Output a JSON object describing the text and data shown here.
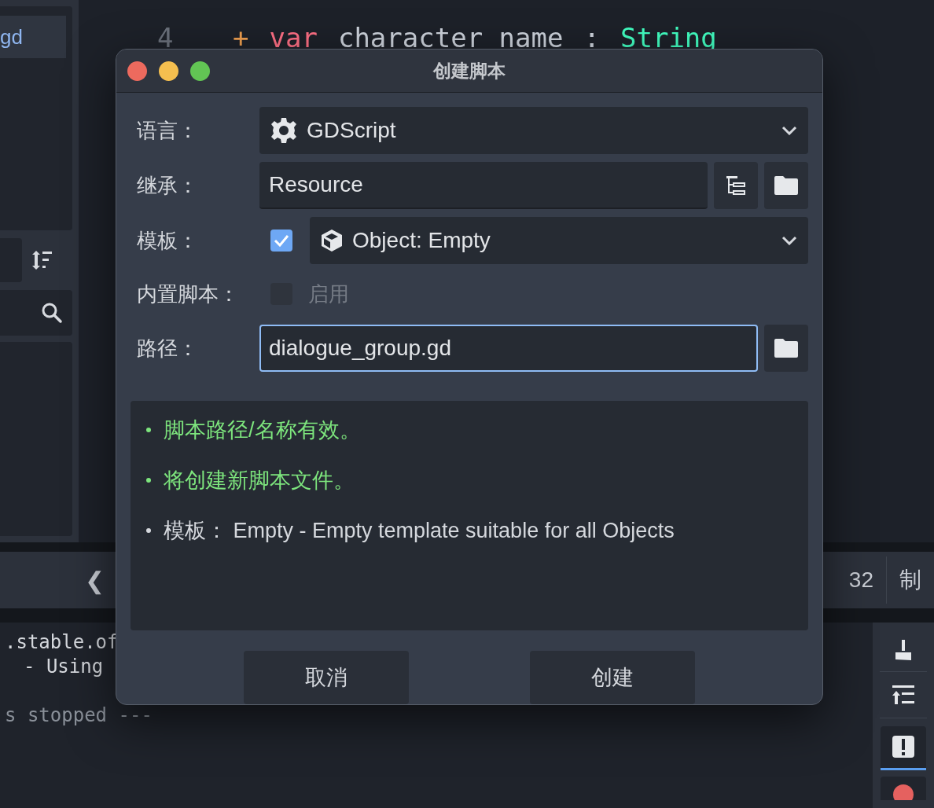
{
  "editor": {
    "file_item": {
      "label": "gd",
      "selected": true
    },
    "code_line": {
      "number": "4",
      "marker": "+",
      "keyword": "var",
      "name": "character name",
      "colon": ":",
      "type": "String"
    },
    "status_bar": {
      "back": "❮",
      "column": "32",
      "indent": "制"
    },
    "output_lines": [
      {
        "text": ".stable.of",
        "kind": "normal"
      },
      {
        "text": "- Using",
        "kind": "normal"
      },
      {
        "text": "s stopped ---",
        "kind": "muted"
      }
    ]
  },
  "dialog": {
    "title": "创建脚本",
    "language": {
      "label": "语言：",
      "value": "GDScript"
    },
    "inherits": {
      "label": "继承：",
      "value": "Resource"
    },
    "template": {
      "label": "模板：",
      "checked": true,
      "value": "Object: Empty"
    },
    "builtin": {
      "label": "内置脚本：",
      "checked": false,
      "disabled": true,
      "option": "启用"
    },
    "path": {
      "label": "路径：",
      "value": "dialogue_group.gd",
      "focused": true
    },
    "messages": [
      {
        "text": "脚本路径/名称有效。",
        "kind": "success"
      },
      {
        "text": "将创建新脚本文件。",
        "kind": "success"
      },
      {
        "text": "模板： Empty - Empty template suitable for all Objects",
        "kind": "info"
      }
    ],
    "buttons": [
      {
        "label": "取消"
      },
      {
        "label": "创建"
      }
    ]
  }
}
